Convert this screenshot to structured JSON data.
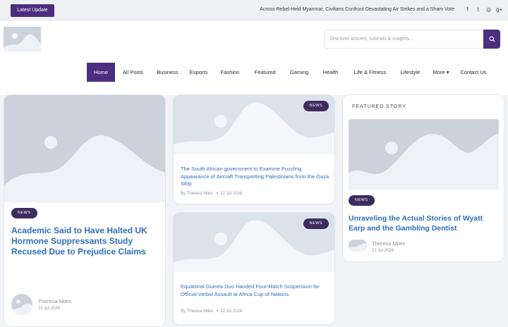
{
  "topbar": {
    "latest_label": "Latest Update",
    "ticker": "Across Rebel-Held Myanmar, Civilians Confront Devastating Air Strikes and a Sham Vote",
    "social": [
      {
        "icon": "facebook-icon",
        "glyph": "f"
      },
      {
        "icon": "twitter-icon",
        "glyph": "t"
      },
      {
        "icon": "instagram-icon",
        "glyph": "◎"
      },
      {
        "icon": "google-plus-icon",
        "glyph": "g+"
      }
    ]
  },
  "search": {
    "placeholder": "Discover articles, tutorials & insights...",
    "value": ""
  },
  "nav": {
    "items": [
      "Home",
      "All Posts",
      "Business",
      "Esports",
      "Fashion",
      "Featured",
      "Gaming",
      "Health",
      "Life & Fitness",
      "Lifestyle",
      "More ▾",
      "Contact Us"
    ],
    "active": "Home"
  },
  "posts": {
    "main": {
      "badge": "NEWS",
      "title": "Academic Said to Have Halted UK Hormone Suppressants Study Recused Due to Prejudice Claims",
      "author": "Theresa Miles",
      "date": "22 Jul 2026"
    },
    "mid_top": {
      "badge": "NEWS",
      "title": "The South African government to Examine Puzzling Appearance of Aircraft Transporting Palestinians from the Gaza Strip",
      "author": "By Theresa Miles",
      "date": "22 Jul 2026"
    },
    "mid_bottom": {
      "badge": "NEWS",
      "title": "Equatorial Guinea Duo Handed Four-Match Suspension for Official Verbal Assault at Africa Cup of Nations.",
      "author": "By Theresa Miles",
      "date": "22 Jul 2026"
    }
  },
  "featured": {
    "heading": "FEATURED STORY",
    "badge": "NEWS",
    "title": "Unraveling the Actual Stories of Wyatt Earp and the Gambling Dentist",
    "author": "Theresa Miles",
    "date": "21 Jul 2026"
  },
  "colors": {
    "accent": "#4b2e7f",
    "link": "#2f6fb8",
    "placeholder_bg": "#cbd2db"
  }
}
